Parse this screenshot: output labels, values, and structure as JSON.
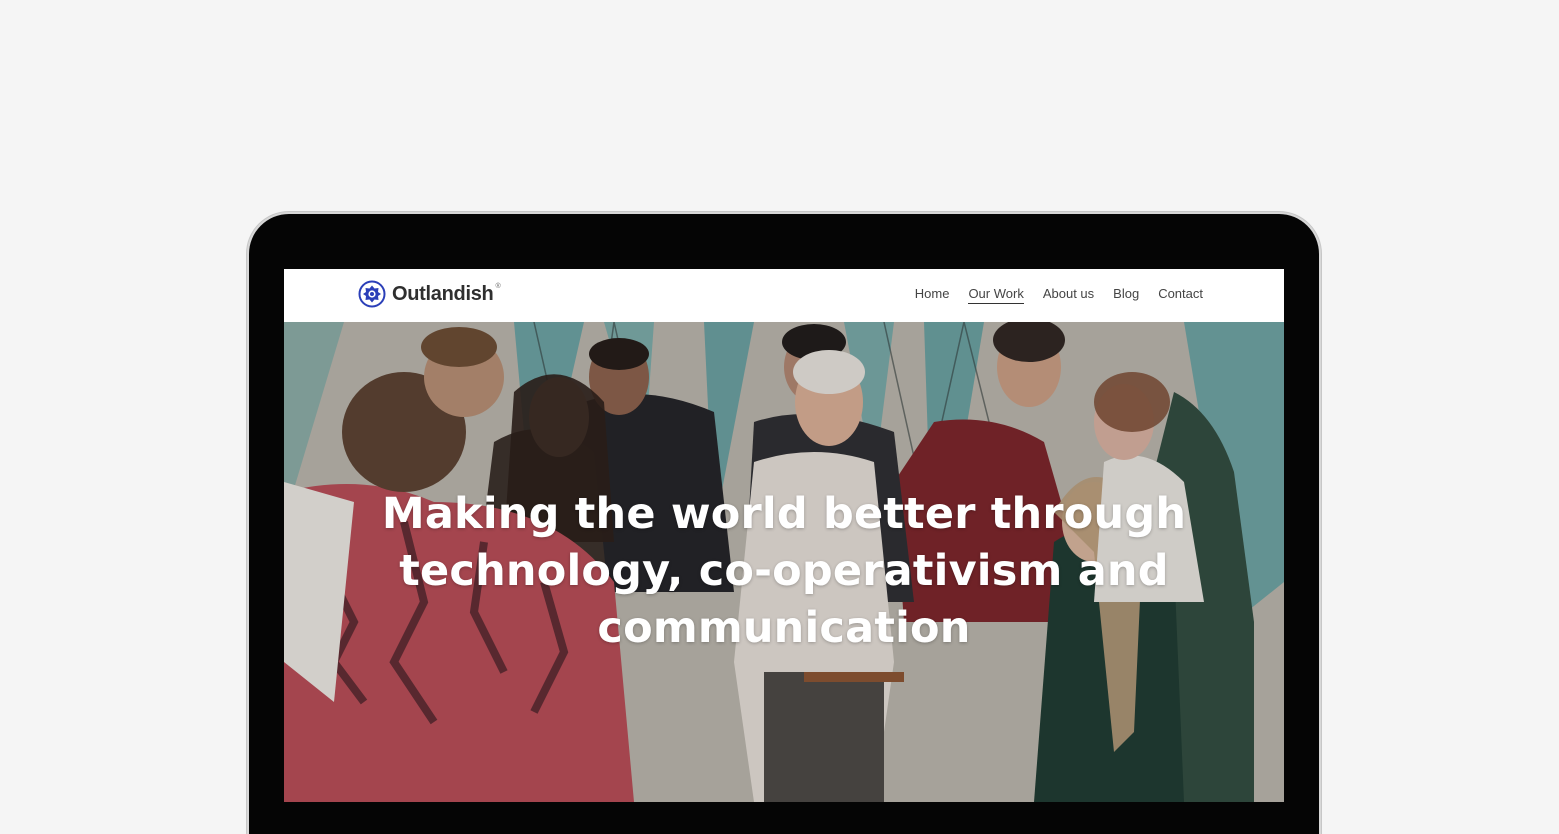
{
  "brand": {
    "name": "Outlandish",
    "registered_mark": "®",
    "logo_icon": "outlandish-logo-icon",
    "accent_color": "#2b3fb8"
  },
  "nav": {
    "items": [
      {
        "label": "Home",
        "active": false
      },
      {
        "label": "Our Work",
        "active": true
      },
      {
        "label": "About us",
        "active": false
      },
      {
        "label": "Blog",
        "active": false
      },
      {
        "label": "Contact",
        "active": false
      }
    ]
  },
  "hero": {
    "heading": "Making the world better through technology, co-operativism and communication",
    "image": "group-of-people-photo"
  },
  "colors": {
    "page_background": "#f5f5f5",
    "device_bezel": "#050505",
    "header_background": "#ffffff",
    "hero_text": "#ffffff"
  }
}
